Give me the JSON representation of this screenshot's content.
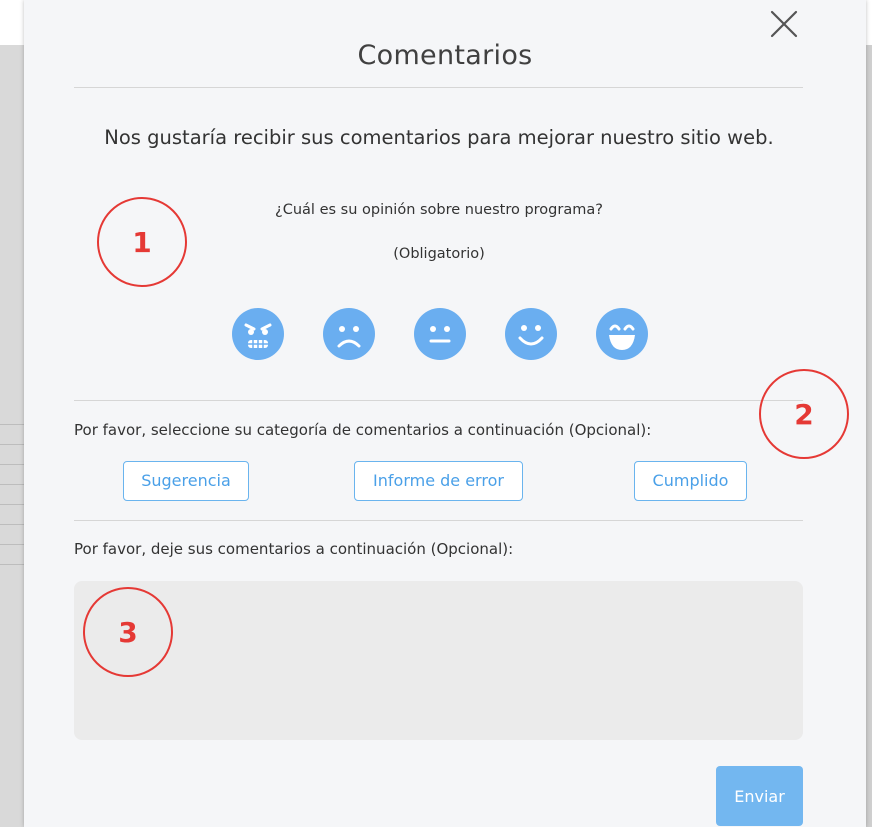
{
  "modal": {
    "title": "Comentarios",
    "intro": "Nos gustaría recibir sus comentarios para mejorar nuestro sitio web.",
    "question": "¿Cuál es su opinión sobre nuestro programa?",
    "required_note": "(Obligatorio)"
  },
  "rating": {
    "faces": [
      "angry-face-icon",
      "sad-face-icon",
      "neutral-face-icon",
      "smile-face-icon",
      "grin-face-icon"
    ],
    "color": "#6aaef0"
  },
  "category": {
    "label": "Por favor, seleccione su categoría de comentarios a continuación (Opcional):",
    "options": [
      "Sugerencia",
      "Informe de error",
      "Cumplido"
    ]
  },
  "comments": {
    "label": "Por favor, deje sus comentarios a continuación (Opcional):",
    "value": ""
  },
  "actions": {
    "send_label": "Enviar"
  },
  "annotations": [
    "1",
    "2",
    "3"
  ],
  "colors": {
    "accent": "#4aa0e8",
    "annotation": "#e53935",
    "send_button": "#73b7f0"
  }
}
